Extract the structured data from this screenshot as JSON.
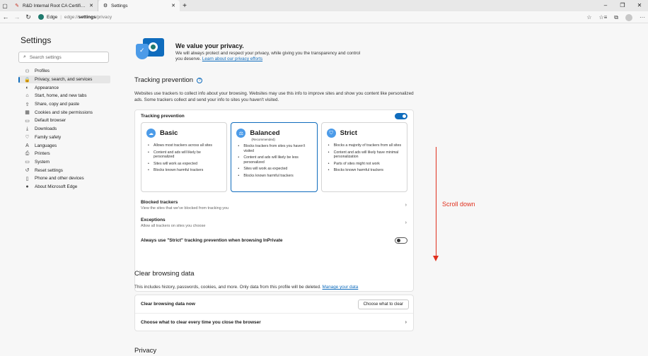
{
  "browser": {
    "tabs": [
      {
        "title": "R&D Internal Root CA Certificat",
        "active": false
      },
      {
        "title": "Settings",
        "active": true
      }
    ],
    "address": {
      "host": "Edge",
      "path_base": "edge://",
      "path_bold": "settings",
      "path_rest": "/privacy"
    }
  },
  "sidebar": {
    "title": "Settings",
    "search_placeholder": "Search settings",
    "items": [
      {
        "label": "Profiles",
        "icon": "person-icon"
      },
      {
        "label": "Privacy, search, and services",
        "icon": "lock-icon"
      },
      {
        "label": "Appearance",
        "icon": "appearance-icon"
      },
      {
        "label": "Start, home, and new tabs",
        "icon": "home-icon"
      },
      {
        "label": "Share, copy and paste",
        "icon": "share-icon"
      },
      {
        "label": "Cookies and site permissions",
        "icon": "cookie-icon"
      },
      {
        "label": "Default browser",
        "icon": "browser-icon"
      },
      {
        "label": "Downloads",
        "icon": "download-icon"
      },
      {
        "label": "Family safety",
        "icon": "family-icon"
      },
      {
        "label": "Languages",
        "icon": "languages-icon"
      },
      {
        "label": "Printers",
        "icon": "printer-icon"
      },
      {
        "label": "System",
        "icon": "system-icon"
      },
      {
        "label": "Reset settings",
        "icon": "reset-icon"
      },
      {
        "label": "Phone and other devices",
        "icon": "phone-icon"
      },
      {
        "label": "About Microsoft Edge",
        "icon": "edge-icon"
      }
    ],
    "selected_index": 1
  },
  "hero": {
    "title": "We value your privacy.",
    "body": "We will always protect and respect your privacy, while giving you the transparency and control you deserve.",
    "link": "Learn about our privacy efforts"
  },
  "tracking": {
    "title": "Tracking prevention",
    "description": "Websites use trackers to collect info about your browsing. Websites may use this info to improve sites and show you content like personalized ads. Some trackers collect and send your info to sites you haven't visited.",
    "toggle_label": "Tracking prevention",
    "toggle_on": true,
    "options": [
      {
        "name": "Basic",
        "sub": "",
        "selected": false,
        "bullets": [
          "Allows most trackers across all sites",
          "Content and ads will likely be personalized",
          "Sites will work as expected",
          "Blocks known harmful trackers"
        ]
      },
      {
        "name": "Balanced",
        "sub": "(Recommended)",
        "selected": true,
        "bullets": [
          "Blocks trackers from sites you haven't visited",
          "Content and ads will likely be less personalized",
          "Sites will work as expected",
          "Blocks known harmful trackers"
        ]
      },
      {
        "name": "Strict",
        "sub": "",
        "selected": false,
        "bullets": [
          "Blocks a majority of trackers from all sites",
          "Content and ads will likely have minimal personalization",
          "Parts of sites might not work",
          "Blocks known harmful trackers"
        ]
      }
    ],
    "blocked": {
      "title": "Blocked trackers",
      "desc": "View the sites that we've blocked from tracking you"
    },
    "exceptions": {
      "title": "Exceptions",
      "desc": "Allow all trackers on sites you choose"
    },
    "strict_inprivate": {
      "label": "Always use \"Strict\" tracking prevention when browsing InPrivate",
      "on": false
    }
  },
  "clear_data": {
    "title": "Clear browsing data",
    "description": "This includes history, passwords, cookies, and more. Only data from this profile will be deleted.",
    "link": "Manage your data",
    "row_now": "Clear browsing data now",
    "button": "Choose what to clear",
    "row_close": "Choose what to clear every time you close the browser"
  },
  "privacy": {
    "title": "Privacy"
  },
  "annotation": {
    "text": "Scroll down",
    "color": "#e0301e"
  },
  "colors": {
    "accent": "#0f6cbd"
  }
}
